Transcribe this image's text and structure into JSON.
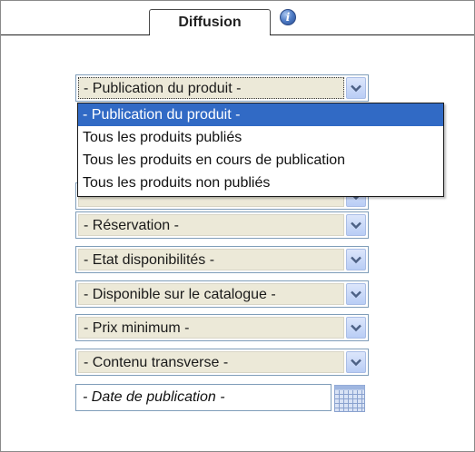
{
  "tab": {
    "label": "Diffusion"
  },
  "info": {
    "glyph": "i",
    "icon": "info-icon"
  },
  "publication_select": {
    "selected": "- Publication du produit -",
    "options": [
      "- Publication du produit -",
      "Tous les produits publiés",
      "Tous les produits en cours de publication",
      "Tous les produits non publiés"
    ]
  },
  "filters": [
    {
      "label": "- Réservation -"
    },
    {
      "label": "- Etat disponibilités -"
    },
    {
      "label": "- Disponible sur le catalogue -"
    },
    {
      "label": "- Prix minimum -"
    },
    {
      "label": "- Contenu transverse -"
    }
  ],
  "date": {
    "value": "- Date de publication -",
    "icon": "calendar-icon"
  },
  "colors": {
    "selection": "#316ac5",
    "select_face": "#ece9d8",
    "border": "#7f9db9",
    "arrow": "#4d6185"
  }
}
